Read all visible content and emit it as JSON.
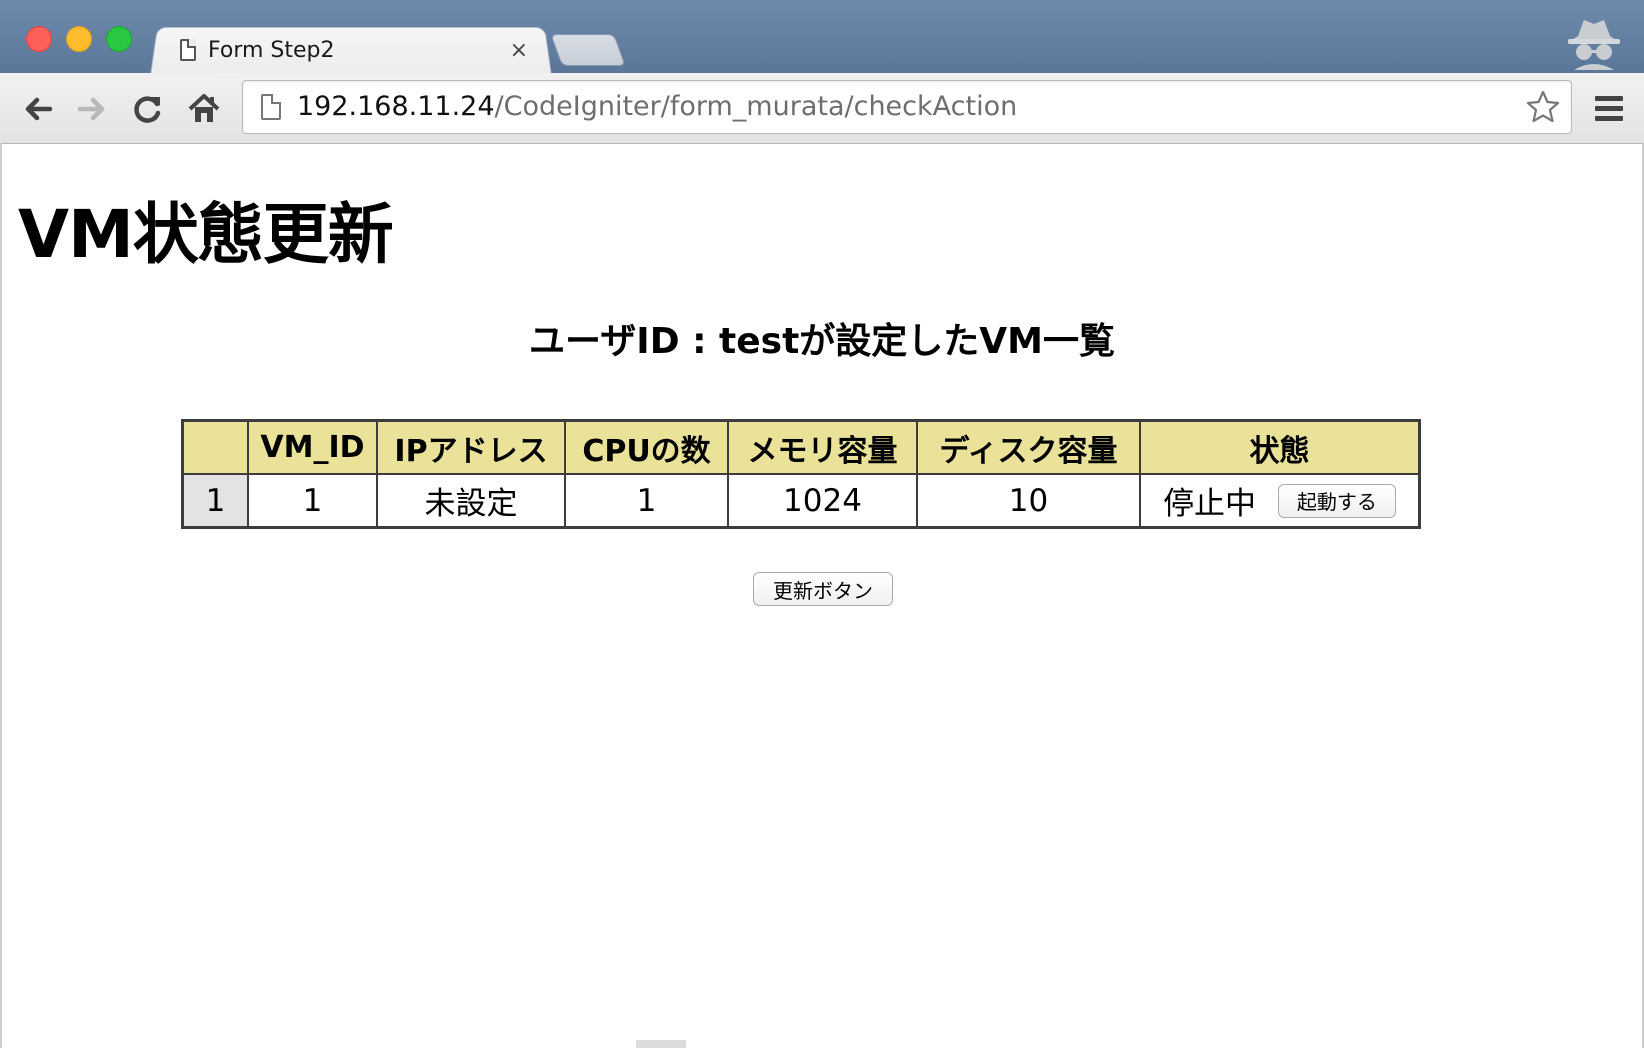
{
  "browser": {
    "tab_title": "Form Step2",
    "tab_close": "×",
    "url_host": "192.168.11.24",
    "url_path": "/CodeIgniter/form_murata/checkAction"
  },
  "page": {
    "title": "VM状態更新",
    "subtitle": "ユーザID : testが設定したVM一覧",
    "table": {
      "headers": [
        "",
        "VM_ID",
        "IPアドレス",
        "CPUの数",
        "メモリ容量",
        "ディスク容量",
        "状態"
      ],
      "rows": [
        {
          "row_no": "1",
          "vm_id": "1",
          "ip": "未設定",
          "cpu": "1",
          "memory": "1024",
          "disk": "10",
          "status": "停止中",
          "action_label": "起動する"
        }
      ]
    },
    "update_button_label": "更新ボタン"
  },
  "colors": {
    "header_bg": "#ebe29a",
    "rownum_bg": "#e3e3e3",
    "table_border": "#3c3c3c",
    "titlebar": "#5a7799"
  }
}
